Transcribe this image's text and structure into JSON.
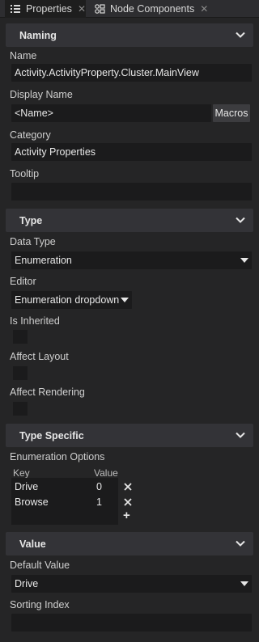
{
  "tabs": [
    {
      "label": "Properties",
      "icon": "list-icon",
      "active": true
    },
    {
      "label": "Node Components",
      "icon": "components-icon",
      "active": false
    }
  ],
  "naming": {
    "title": "Naming",
    "name_label": "Name",
    "name_value": "Activity.ActivityProperty.Cluster.MainView",
    "display_name_label": "Display Name",
    "display_name_value": "<Name>",
    "macros_label": "Macros",
    "category_label": "Category",
    "category_value": "Activity Properties",
    "tooltip_label": "Tooltip",
    "tooltip_value": ""
  },
  "type": {
    "title": "Type",
    "data_type_label": "Data Type",
    "data_type_value": "Enumeration",
    "editor_label": "Editor",
    "editor_value": "Enumeration dropdown",
    "is_inherited_label": "Is Inherited",
    "is_inherited_checked": false,
    "affect_layout_label": "Affect Layout",
    "affect_layout_checked": false,
    "affect_rendering_label": "Affect Rendering",
    "affect_rendering_checked": false
  },
  "type_specific": {
    "title": "Type Specific",
    "enum_options_label": "Enumeration Options",
    "key_header": "Key",
    "value_header": "Value",
    "options": [
      {
        "key": "Drive",
        "value": "0"
      },
      {
        "key": "Browse",
        "value": "1"
      }
    ],
    "add_symbol": "+"
  },
  "value": {
    "title": "Value",
    "default_value_label": "Default Value",
    "default_value": "Drive",
    "sorting_index_label": "Sorting Index",
    "sorting_index_value": ""
  },
  "colors": {
    "background": "#252526",
    "section_header": "#333337",
    "field": "#1b1b1c",
    "button": "#3c3c3f"
  }
}
